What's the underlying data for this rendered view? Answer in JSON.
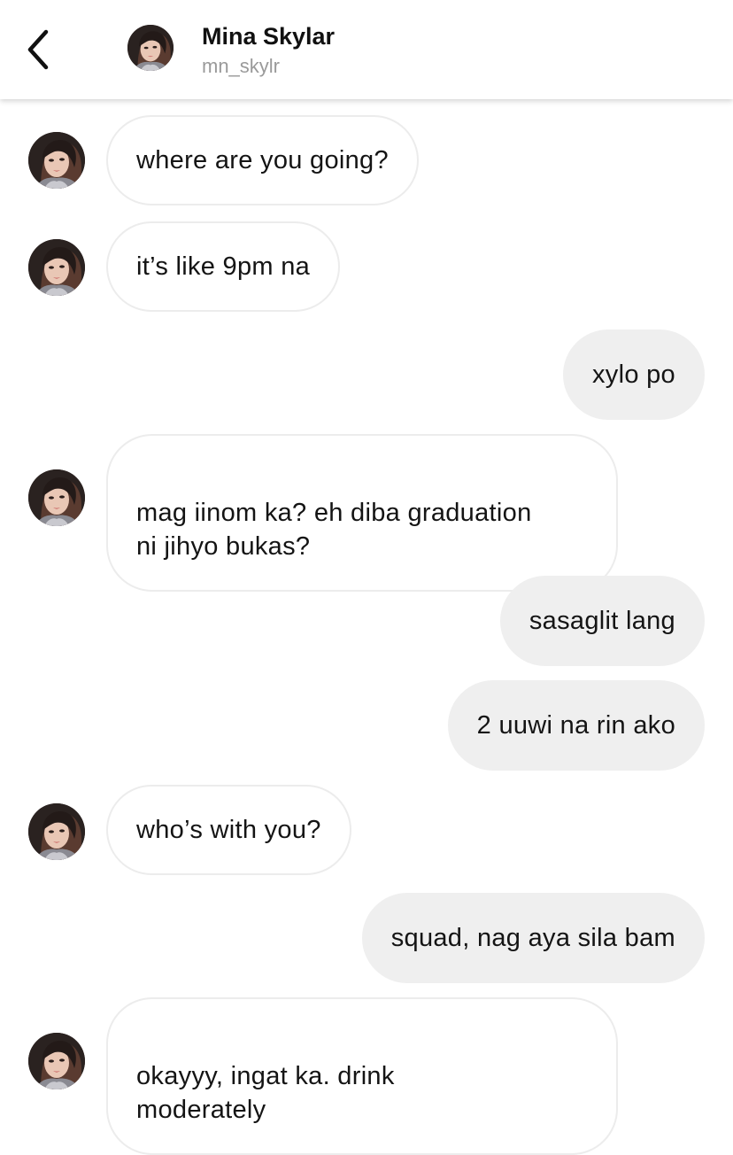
{
  "header": {
    "name": "Mina Skylar",
    "handle": "mn_skylr"
  },
  "messages": [
    {
      "from": "them",
      "text": "where are you going?"
    },
    {
      "from": "them",
      "text": "it’s like 9pm na"
    },
    {
      "from": "me",
      "text": "xylo po"
    },
    {
      "from": "them",
      "text": "mag iinom ka? eh diba graduation\nni jihyo bukas?"
    },
    {
      "from": "me",
      "text": "sasaglit lang"
    },
    {
      "from": "me",
      "text": "2 uuwi na rin ako"
    },
    {
      "from": "them",
      "text": "who’s with you?"
    },
    {
      "from": "me",
      "text": "squad, nag aya sila bam"
    },
    {
      "from": "them",
      "text": "okayyy, ingat ka. drink\nmoderately"
    }
  ],
  "icons": {
    "back": "chevron-left-icon",
    "avatar": "profile-photo"
  },
  "colors": {
    "incoming_bubble": "#ffffff",
    "incoming_border": "#ececec",
    "outgoing_bubble": "#efefef",
    "handle_text": "#9a9a9a"
  }
}
